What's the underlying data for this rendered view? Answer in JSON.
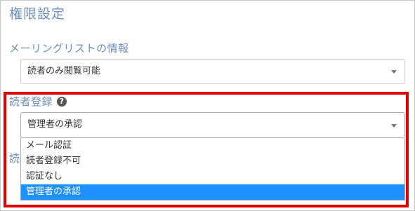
{
  "page": {
    "title": "権限設定"
  },
  "mailing_list": {
    "label": "メーリングリストの情報",
    "selected": "読者のみ閲覧可能"
  },
  "reader_registration": {
    "label": "読者登録",
    "help_icon": "question-circle-icon",
    "selected": "管理者の承認",
    "options": [
      {
        "label": "メール認証",
        "selected": false
      },
      {
        "label": "読者登録不可",
        "selected": false
      },
      {
        "label": "認証なし",
        "selected": false
      },
      {
        "label": "管理者の承認",
        "selected": true
      }
    ]
  },
  "obscured": {
    "label_fragment": "読"
  },
  "colors": {
    "heading": "#6c8fb8",
    "highlight_border": "#e00000",
    "selected_option_bg": "#1e90ff"
  }
}
